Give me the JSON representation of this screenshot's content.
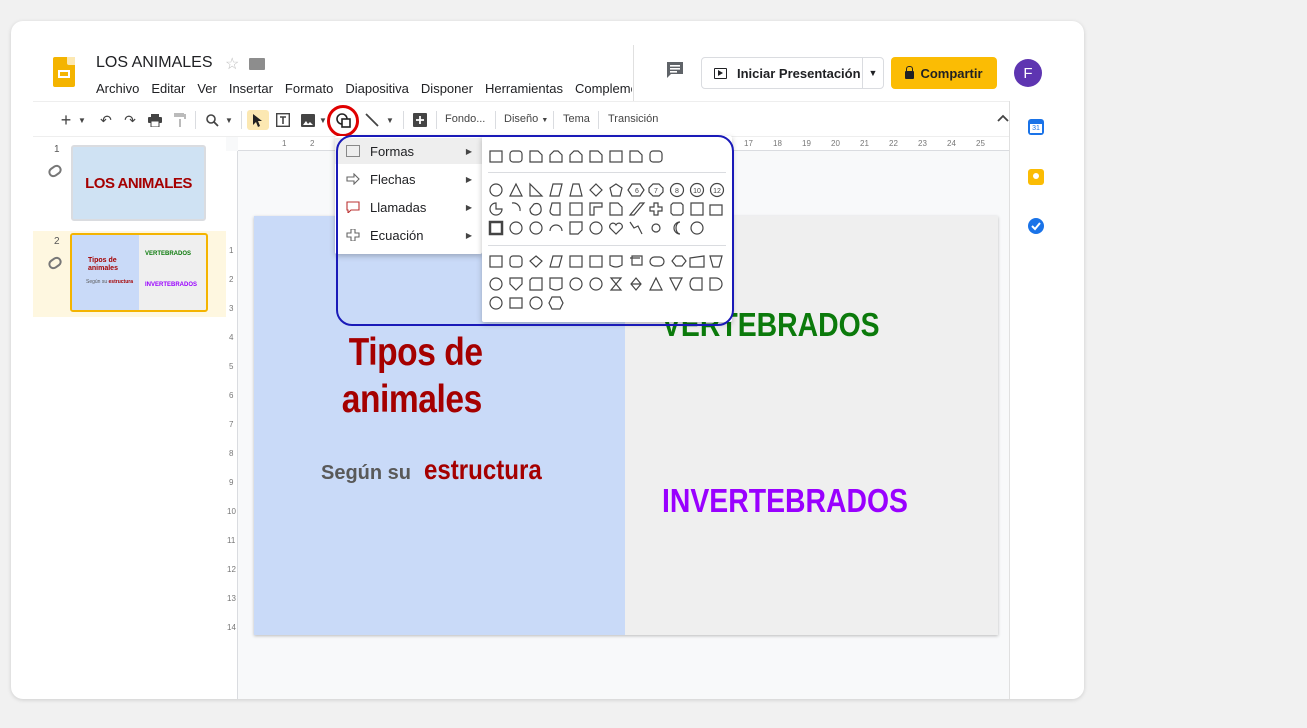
{
  "document": {
    "title": "LOS ANIMALES"
  },
  "menu_bar": [
    "Archivo",
    "Editar",
    "Ver",
    "Insertar",
    "Formato",
    "Diapositiva",
    "Disponer",
    "Herramientas",
    "Complementos"
  ],
  "header": {
    "present_label": "Iniciar Presentación",
    "share_label": "Compartir",
    "avatar_initial": "F",
    "share_color": "#fbbc04"
  },
  "toolbar": {
    "background_label": "Fondo...",
    "design_label": "Diseño",
    "theme_label": "Tema",
    "transition_label": "Transición"
  },
  "ruler": {
    "horizontal": [
      "1",
      "2",
      "17",
      "18",
      "19",
      "20",
      "21",
      "22",
      "23",
      "24",
      "25"
    ],
    "vertical": [
      "1",
      "2",
      "3",
      "4",
      "5",
      "6",
      "7",
      "8",
      "9",
      "10",
      "11",
      "12",
      "13",
      "14"
    ]
  },
  "filmstrip": [
    {
      "number": "1",
      "title": "LOS ANIMALES"
    },
    {
      "number": "2",
      "title": "Tipos de animales",
      "subtitle_a": "Según su",
      "subtitle_b": "estructura",
      "right_top": "VERTEBRADOS",
      "right_bottom": "INVERTEBRADOS"
    }
  ],
  "slide": {
    "title_line1": "Tipos de",
    "title_line2": "animales",
    "subtitle_a": "Según su",
    "subtitle_b": "estructura",
    "vertebrates": "VERTEBRADOS",
    "invertebrates": "INVERTEBRADOS",
    "colors": {
      "left_bg": "#c9daf8",
      "right_bg": "#efefef",
      "title": "#a50000",
      "vert": "#0b7a0b",
      "invert": "#9900ff"
    }
  },
  "shape_menu": {
    "items": [
      {
        "label": "Formas",
        "icon": "rectangle-icon"
      },
      {
        "label": "Flechas",
        "icon": "arrow-icon"
      },
      {
        "label": "Llamadas",
        "icon": "callout-icon"
      },
      {
        "label": "Ecuación",
        "icon": "plus-icon"
      }
    ]
  },
  "shape_numbers": [
    "6",
    "7",
    "8",
    "10",
    "12"
  ]
}
